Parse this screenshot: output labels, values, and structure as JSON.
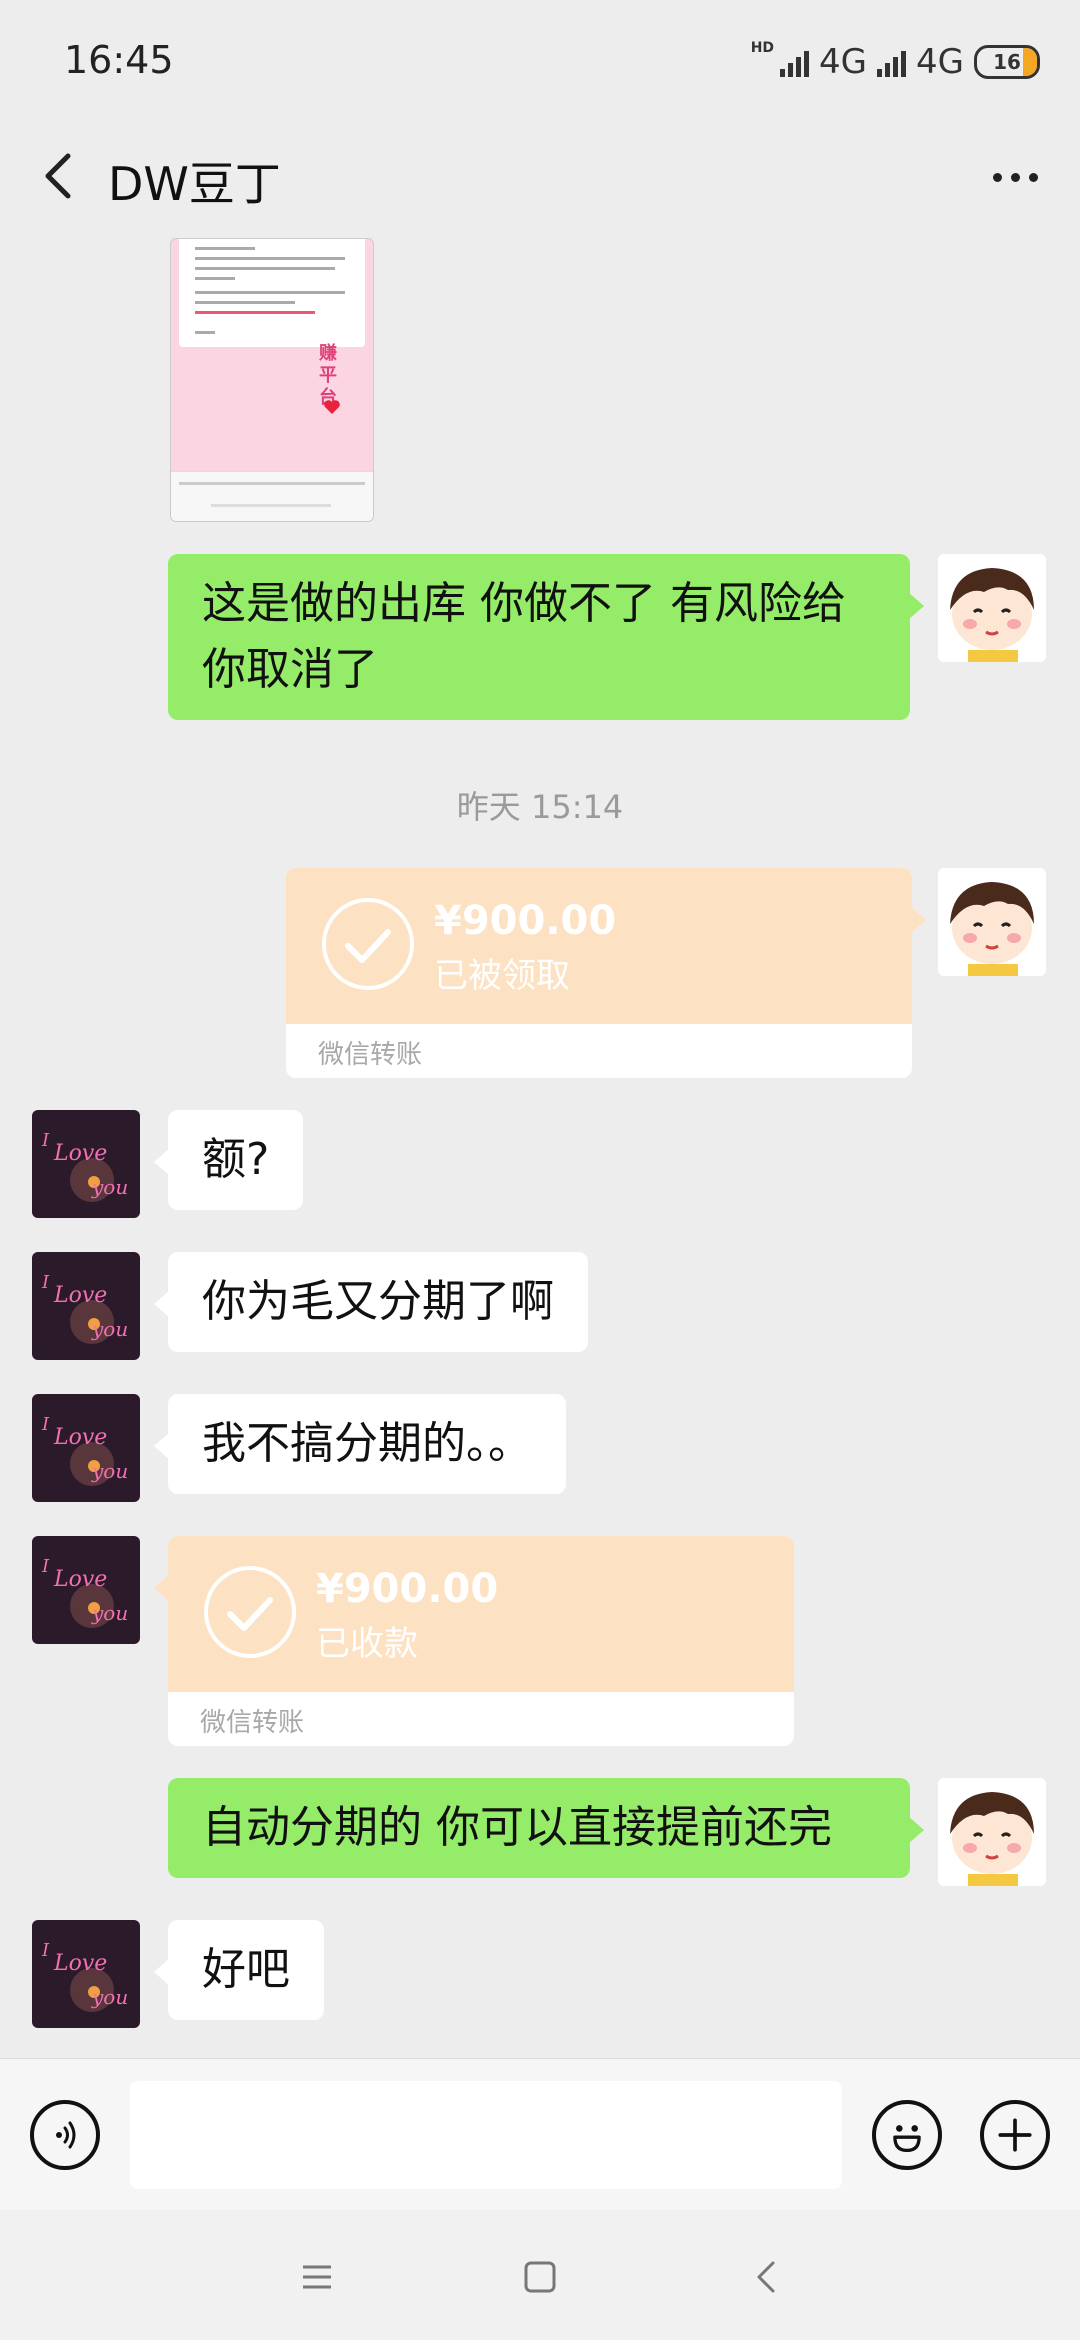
{
  "status": {
    "time": "16:45",
    "net1": "4G",
    "net2": "4G",
    "hd": "HD",
    "battery": "16"
  },
  "header": {
    "title": "DW豆丁"
  },
  "messages": {
    "m1": "这是做的出库  你做不了  有风险给你取消了",
    "time1": "昨天 15:14",
    "transfer1": {
      "amount": "¥900.00",
      "state": "已被领取",
      "label": "微信转账"
    },
    "m2": "额?",
    "m3": "你为毛又分期了啊",
    "m4": "我不搞分期的。。",
    "transfer2": {
      "amount": "¥900.00",
      "state": "已收款",
      "label": "微信转账"
    },
    "m5": "自动分期的  你可以直接提前还完",
    "m6": "好吧"
  },
  "screenshot_text": {
    "ptext": "赚平台"
  },
  "input": {
    "placeholder": ""
  },
  "colors": {
    "my_bubble": "#95ec69",
    "their_bubble": "#ffffff",
    "transfer": "#fde1c3",
    "background": "#ededed"
  }
}
